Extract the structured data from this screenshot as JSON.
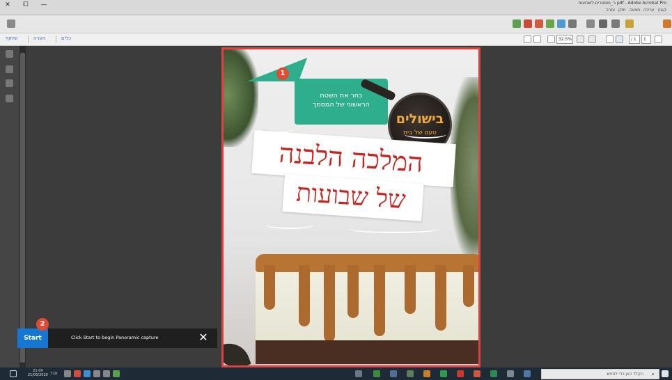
{
  "window": {
    "title": "pdf - Adobe Acrobat Pro ג'_פוסטרים-לשבועות",
    "menu": "קובץ  עריכה  תצוגה  חלון  עזרה",
    "controls": {
      "close": "✕",
      "restore": "⧠",
      "minimize": "—"
    }
  },
  "toolbar2": {
    "tools_label": "כלים",
    "comment_label": "הערה",
    "share_label": "שיתוף",
    "zoom_value": "32.5%",
    "page_current": "1",
    "page_total": "/ 1"
  },
  "document": {
    "callout": {
      "line1": "בחר את השטח",
      "line2": "הראשוני של המסמך",
      "step": "1"
    },
    "brand": {
      "name": "בישולים",
      "tagline": "טעם של בית"
    },
    "headline": {
      "line1": "המלכה הלבנה",
      "line2": "של שבועות"
    }
  },
  "capture_overlay": {
    "start_label": "Start",
    "step": "2",
    "hint": "Click Start to begin Panoramic capture",
    "close_label": "✕"
  },
  "taskbar": {
    "search_placeholder": "הקלד כאן כדי לחפש",
    "clock_time": "21:09",
    "clock_date": "21/05/2020",
    "language": "עבר"
  },
  "colors": {
    "accent_red": "#e24141",
    "callout_teal": "#2fae8e",
    "badge_red": "#e44a32",
    "start_blue": "#1477d4",
    "headline_red": "#c8241f"
  }
}
